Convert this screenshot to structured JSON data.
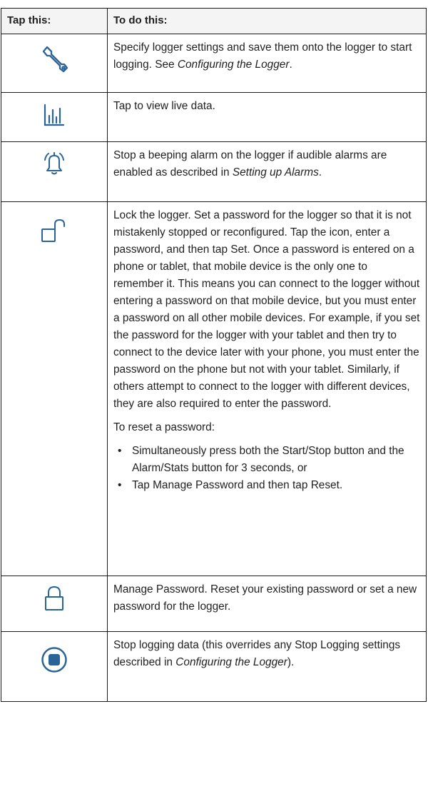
{
  "table": {
    "header": {
      "col1": "Tap this:",
      "col2": "To do this:"
    },
    "rows": [
      {
        "icon": "wrench-icon",
        "before": "Specify logger settings and save them onto the logger to start logging. See ",
        "ref": "Configuring the Logger",
        "after": "."
      },
      {
        "icon": "bar-chart-icon",
        "text": "Tap to view live data."
      },
      {
        "icon": "bell-alarm-icon",
        "before": "Stop a beeping alarm on the logger if audible alarms are enabled as described in ",
        "ref": "Setting up Alarms",
        "after": "."
      },
      {
        "icon": "unlocked-padlock-icon",
        "paragraph": "Lock the logger. Set a password for the logger so that it is not mistakenly stopped or reconfigured. Tap the icon, enter a password, and then tap Set. Once a password is entered on a phone or tablet, that mobile device is the only one to remember it. This means you can connect to the logger without entering a password on that mobile device, but you must enter a password on all other mobile devices. For example, if you set the password for the logger with your tablet and then try to connect to the device later with your phone, you must enter the password on the phone but not with your tablet. Similarly, if others attempt to connect to the logger with different devices, they are also required to enter the password.",
        "reset_intro": "To reset a password:",
        "bullets": [
          "Simultaneously press both the Start/Stop button and the Alarm/Stats button for 3 seconds, or",
          "Tap Manage Password and then tap Reset."
        ]
      },
      {
        "icon": "locked-padlock-icon",
        "text": "Manage Password. Reset your existing password or set a new password for the logger."
      },
      {
        "icon": "stop-circle-icon",
        "before": "Stop logging data (this overrides any Stop Logging settings described in ",
        "ref": "Configuring the Logger",
        "after": ")."
      }
    ]
  },
  "colors": {
    "icon": "#2a6496",
    "border": "#1a1a1a",
    "header_bg": "#f4f4f4"
  }
}
